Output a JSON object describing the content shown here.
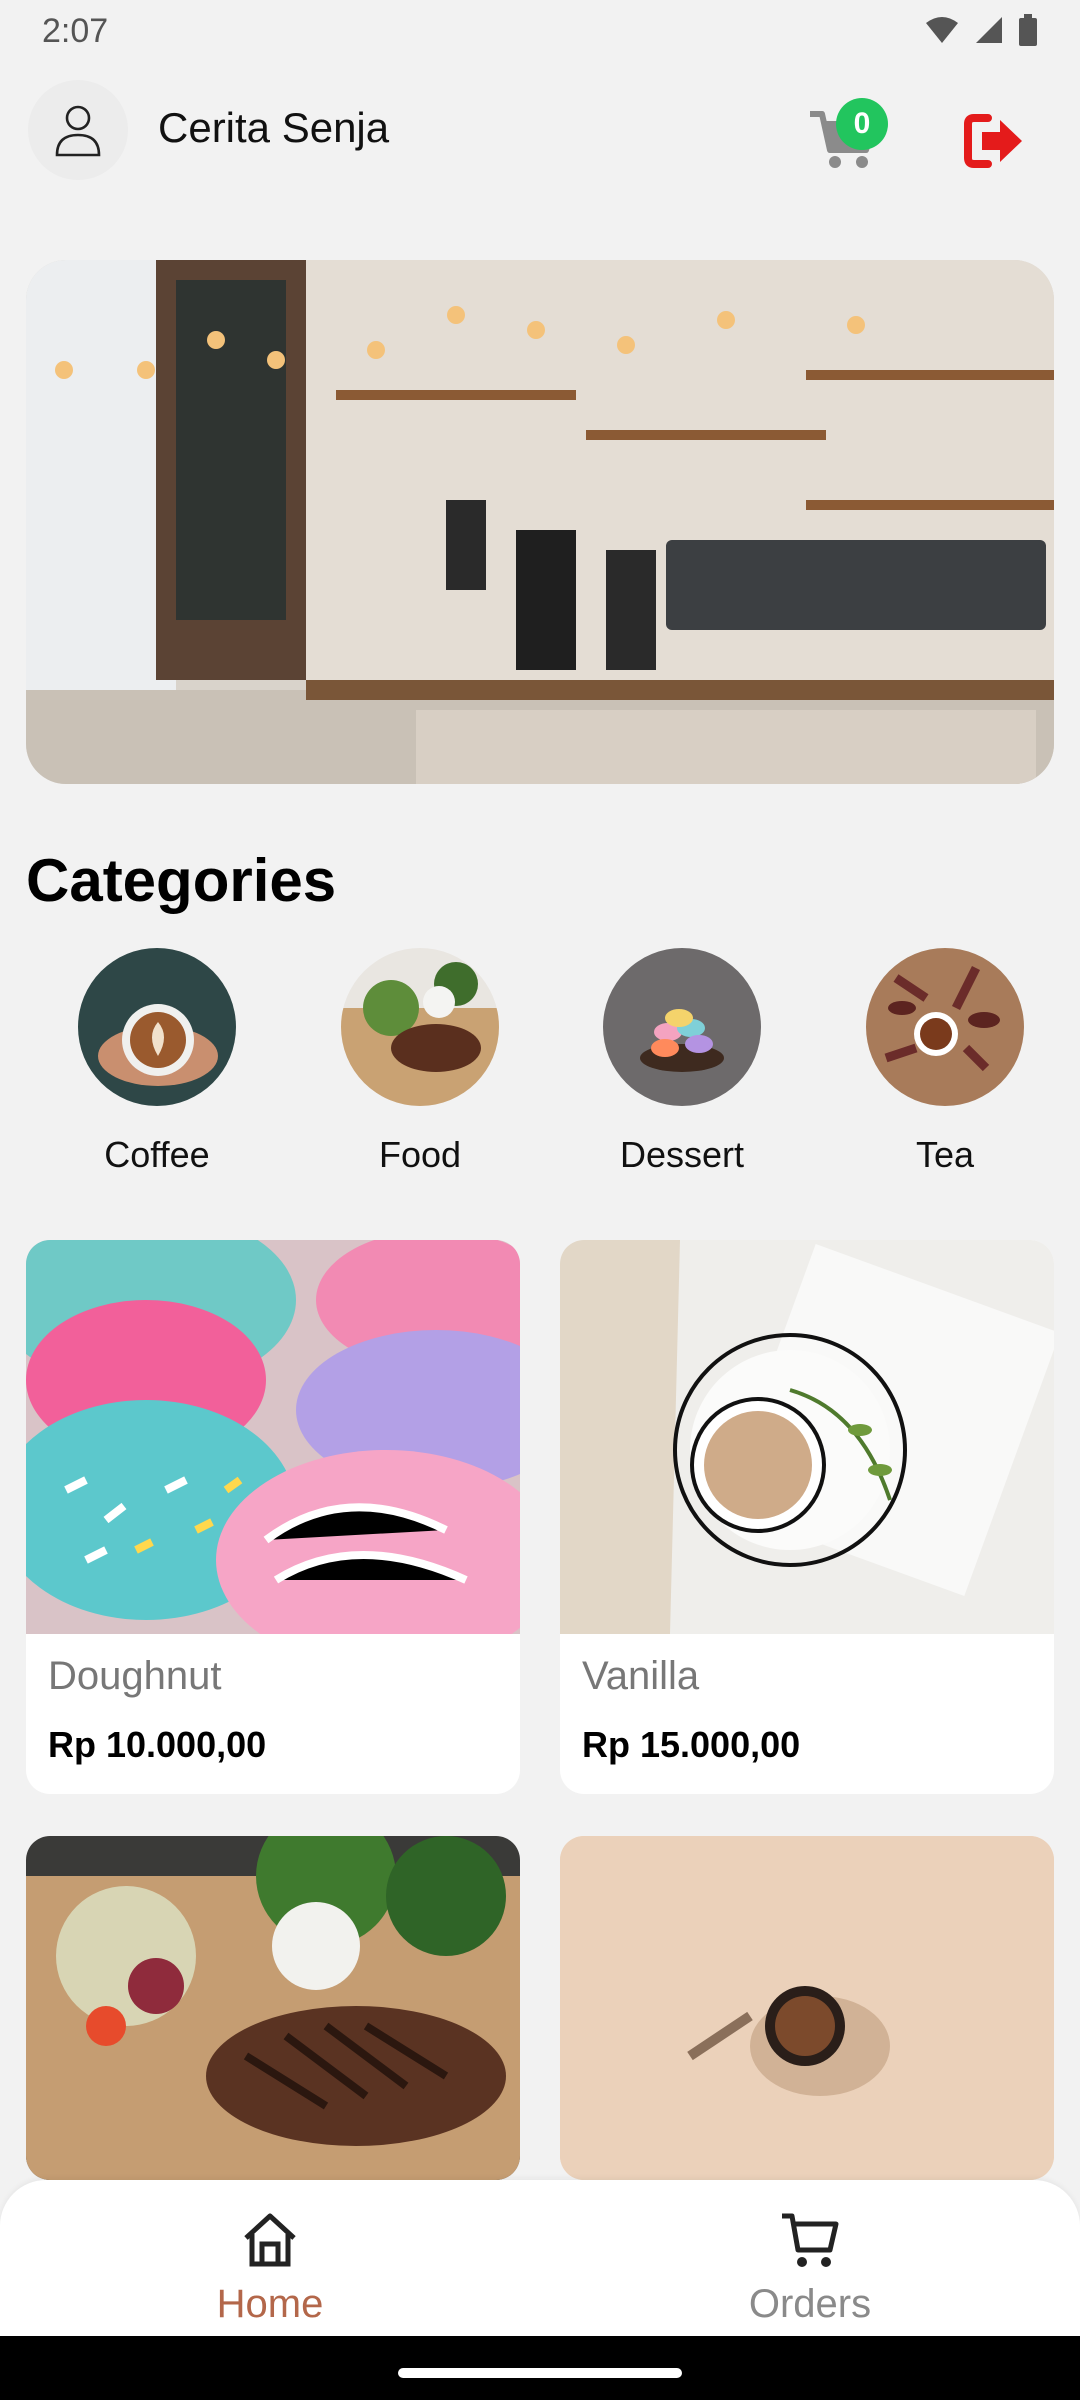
{
  "status_bar": {
    "time": "2:07",
    "icons": [
      "wifi-icon",
      "signal-icon",
      "battery-icon"
    ]
  },
  "header": {
    "user_name": "Cerita Senja",
    "avatar_icon": "user-icon",
    "cart_count": "0",
    "cart_icon": "cart-icon",
    "logout_icon": "logout-icon",
    "colors": {
      "badge": "#22c55e",
      "logout": "#e41b1b"
    }
  },
  "banner": {
    "image": "cafe-interior-photo"
  },
  "categories": {
    "title": "Categories",
    "items": [
      {
        "label": "Coffee"
      },
      {
        "label": "Food"
      },
      {
        "label": "Dessert"
      },
      {
        "label": "Tea"
      }
    ]
  },
  "products": [
    {
      "name": "Doughnut",
      "price": "Rp 10.000,00"
    },
    {
      "name": "Vanilla",
      "price": "Rp 15.000,00"
    },
    {
      "name": "",
      "price": ""
    },
    {
      "name": "",
      "price": ""
    }
  ],
  "bottom_nav": {
    "items": [
      {
        "label": "Home",
        "icon": "home-icon",
        "active": true
      },
      {
        "label": "Orders",
        "icon": "cart-icon",
        "active": false
      }
    ],
    "colors": {
      "active": "#b3674a",
      "inactive": "#8a8a8a"
    }
  }
}
